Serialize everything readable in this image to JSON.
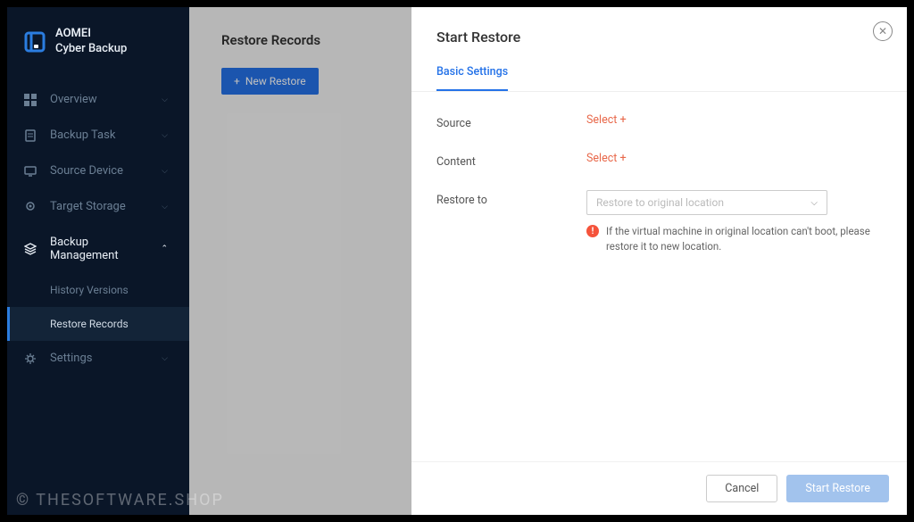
{
  "app": {
    "name_line1": "AOMEI",
    "name_line2": "Cyber Backup"
  },
  "sidebar": {
    "items": [
      {
        "label": "Overview"
      },
      {
        "label": "Backup Task"
      },
      {
        "label": "Source Device"
      },
      {
        "label": "Target Storage"
      },
      {
        "label": "Backup Management"
      },
      {
        "label": "Settings"
      }
    ],
    "sub_items": [
      {
        "label": "History Versions"
      },
      {
        "label": "Restore Records"
      }
    ]
  },
  "main": {
    "title": "Restore Records",
    "new_button": "New Restore"
  },
  "modal": {
    "title": "Start Restore",
    "tab": "Basic Settings",
    "fields": {
      "source_label": "Source",
      "source_action": "Select",
      "content_label": "Content",
      "content_action": "Select",
      "restoreto_label": "Restore to",
      "restoreto_placeholder": "Restore to original location",
      "info_text": "If the virtual machine in original location can't boot, please restore it to new location."
    },
    "footer": {
      "cancel": "Cancel",
      "start": "Start Restore"
    }
  },
  "watermark": "© THESOFTWARE.SHOP"
}
